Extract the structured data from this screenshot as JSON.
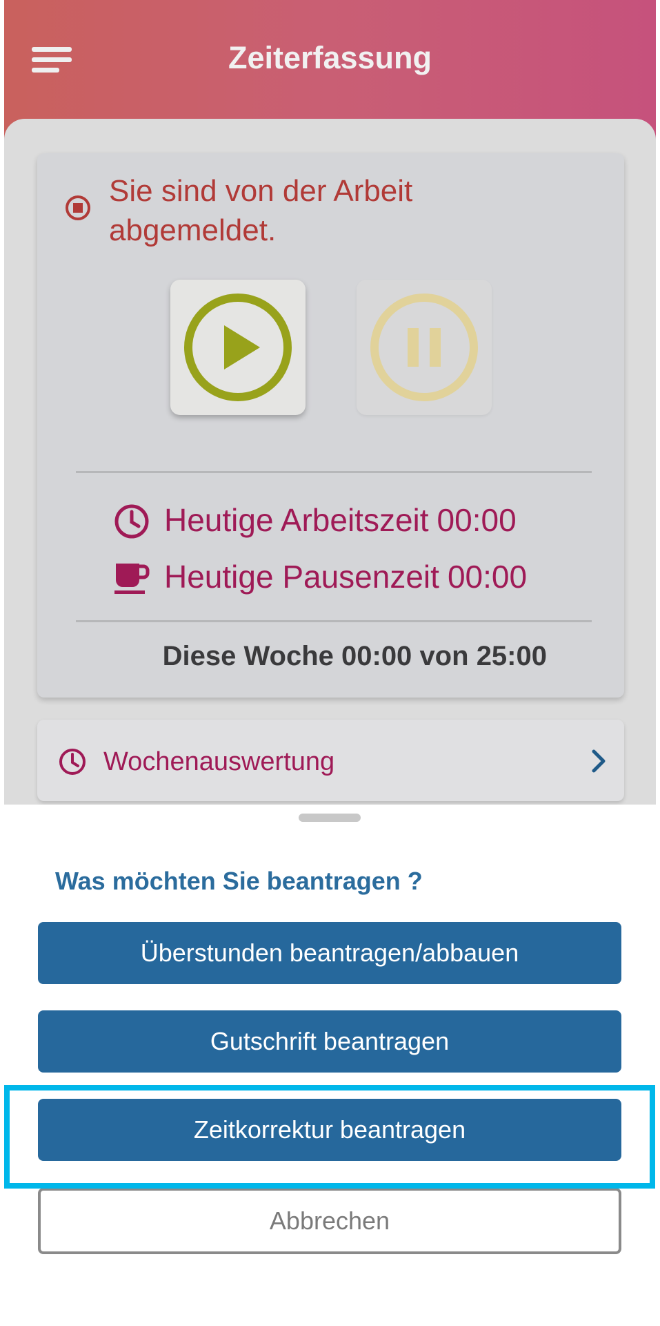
{
  "header": {
    "title": "Zeiterfassung",
    "menu_icon": "hamburger-menu-icon"
  },
  "status": {
    "text": "Sie sind von der Arbeit abgemeldet.",
    "icon": "stop-circle-icon",
    "color": "#b13a37"
  },
  "controls": {
    "play": {
      "icon": "play-icon",
      "color": "#98a21b"
    },
    "pause": {
      "icon": "pause-icon",
      "color": "#e1d29a"
    }
  },
  "stats": {
    "work": {
      "label": "Heutige Arbeitszeit",
      "value": "00:00",
      "icon": "clock-icon"
    },
    "pause": {
      "label": "Heutige Pausenzeit",
      "value": "00:00",
      "icon": "coffee-cup-icon"
    },
    "week": {
      "label": "Diese Woche",
      "value": "00:00",
      "of": "von",
      "total": "25:00"
    },
    "accent_color": "#9f1a56"
  },
  "week_row": {
    "label": "Wochenauswertung",
    "icon": "clock-icon",
    "chevron": "chevron-right-icon"
  },
  "sheet": {
    "title": "Was möchten Sie beantragen ?",
    "options": [
      {
        "label": "Überstunden beantragen/abbauen"
      },
      {
        "label": "Gutschrift beantragen"
      },
      {
        "label": "Zeitkorrektur beantragen"
      }
    ],
    "cancel_label": "Abbrechen",
    "button_color": "#26689c"
  },
  "highlight": {
    "target": "Zeitkorrektur beantragen",
    "color": "#00b7ea"
  }
}
